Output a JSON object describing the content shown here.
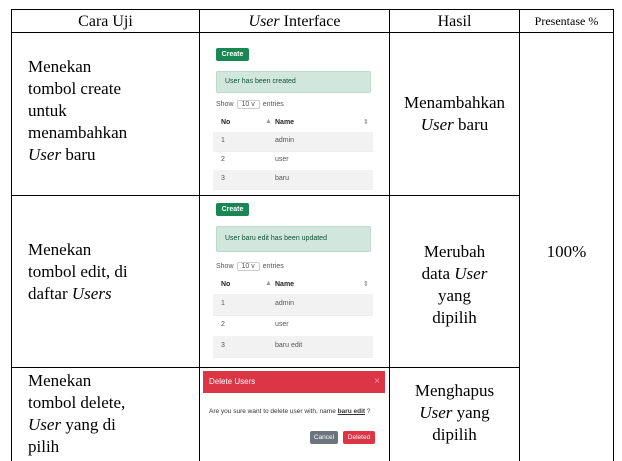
{
  "header": {
    "col1": "Cara Uji",
    "col2_italic": "User",
    "col2_rest": " Interface",
    "col3": "Hasil",
    "col4": "Presentase %"
  },
  "rows": [
    {
      "method_lines": [
        "Menekan",
        "tombol create",
        "untuk",
        "menambahkan"
      ],
      "method_last_italic": "User",
      "method_last_rest": " baru",
      "result_line1": "Menambahkan",
      "result_line2_italic": "User",
      "result_line2_rest": " baru",
      "shot": {
        "create_label": "Create",
        "alert_text": "User has been created",
        "show_label": "Show",
        "show_value": "10",
        "chevron": "v",
        "entries_label": "entries",
        "col_no": "No",
        "col_name": "Name",
        "rows": [
          {
            "no": "1",
            "name": "admin"
          },
          {
            "no": "2",
            "name": "user"
          },
          {
            "no": "3",
            "name": "baru"
          }
        ]
      }
    },
    {
      "method_lines": [
        "Menekan",
        "tombol edit, di"
      ],
      "method_last_plain": "daftar ",
      "method_last_italic": "Users",
      "result_lines": [
        "Merubah"
      ],
      "result_mid_plain": "data ",
      "result_mid_italic": "User",
      "result_tail": [
        "yang",
        "dipilih"
      ],
      "shot": {
        "create_label": "Create",
        "alert_text": "User baru edit has been updated",
        "show_label": "Show",
        "show_value": "10",
        "chevron": "v",
        "entries_label": "entries",
        "col_no": "No",
        "col_name": "Name",
        "rows": [
          {
            "no": "1",
            "name": "admin"
          },
          {
            "no": "2",
            "name": "user"
          },
          {
            "no": "3",
            "name": "baru edit"
          }
        ]
      }
    },
    {
      "method_lines": [
        "Menekan",
        "tombol delete,"
      ],
      "method_italic_line_italic": "User",
      "method_italic_line_rest": " yang di",
      "method_last": "pilih",
      "result_line1": "Menghapus",
      "result_line2_italic": "User",
      "result_line2_rest": " yang",
      "result_line3": "dipilih",
      "modal": {
        "title": "Delete Users",
        "close": "×",
        "message_pre": "Are you sure want to delete user with, name ",
        "message_name": "baru edit",
        "message_post": " ?",
        "cancel_label": "Cancel",
        "delete_label": "Deleted"
      }
    }
  ],
  "percentage": "100%"
}
